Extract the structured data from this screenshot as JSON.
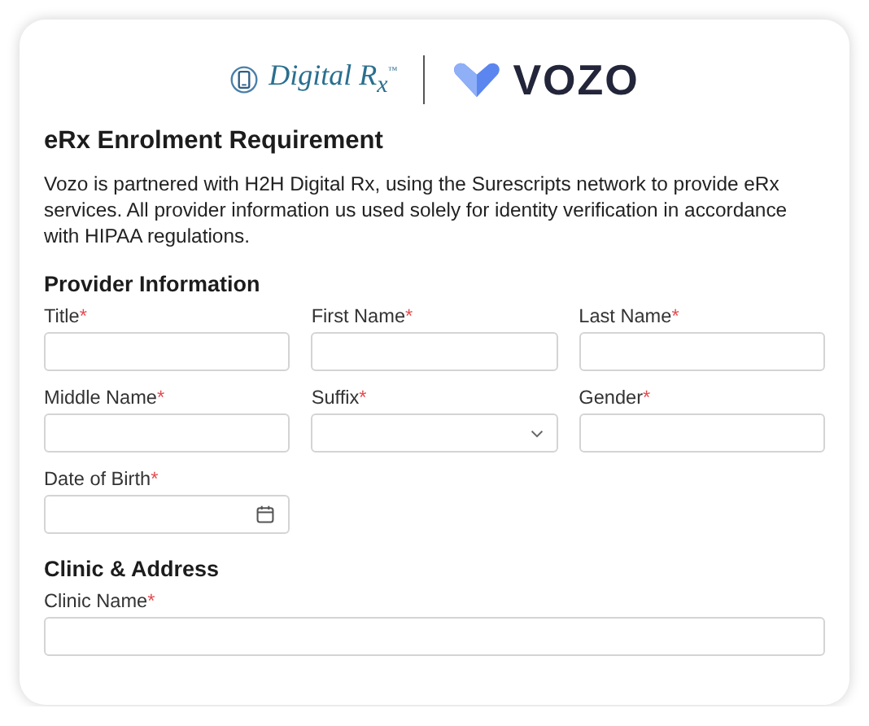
{
  "logos": {
    "partner": "Digital R$_{x}$$^{™}$",
    "brand": "VOZO"
  },
  "heading": "eRx Enrolment Requirement",
  "intro": "Vozo is partnered with H2H Digital Rx, using the Surescripts network to provide eRx services. All provider information us used solely for identity verification in accordance with HIPAA regulations.",
  "sections": [
    {
      "title": "Provider Information",
      "kind": "grid",
      "fields": [
        {
          "label": "Title",
          "required_mark": "*",
          "kind": "text"
        },
        {
          "label": "First Name",
          "required_mark": "*",
          "kind": "text"
        },
        {
          "label": "Last Name",
          "required_mark": "*",
          "kind": "text"
        },
        {
          "label": "Middle Name",
          "required_mark": "*",
          "kind": "text"
        },
        {
          "label": "Suffix",
          "required_mark": "*",
          "kind": "select"
        },
        {
          "label": "Gender",
          "required_mark": "*",
          "kind": "text"
        },
        {
          "label": "Date of Birth",
          "required_mark": "*",
          "kind": "date"
        }
      ]
    },
    {
      "title": "Clinic & Address",
      "kind": "single",
      "fields": [
        {
          "label": "Clinic Name",
          "required_mark": "*",
          "kind": "text"
        }
      ]
    }
  ]
}
